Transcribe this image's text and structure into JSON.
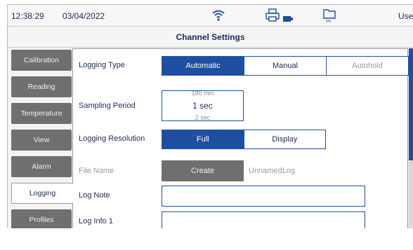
{
  "status_bar": {
    "time": "12:38:29",
    "date": "03/04/2022",
    "user": "User",
    "icons": [
      "wifi-icon",
      "printer-icon",
      "battery-icon",
      "storage-icon"
    ],
    "storage_label": "0%"
  },
  "title": "Channel Settings",
  "sidebar": {
    "items": [
      {
        "label": "Calibration"
      },
      {
        "label": "Reading"
      },
      {
        "label": "Temperature"
      },
      {
        "label": "View"
      },
      {
        "label": "Alarm"
      },
      {
        "label": "Logging",
        "active": true
      },
      {
        "label": "Profiles"
      }
    ]
  },
  "form": {
    "logging_type": {
      "label": "Logging Type",
      "options": [
        "Automatic",
        "Manual",
        "Autohold"
      ],
      "selected": "Automatic"
    },
    "sampling_period": {
      "label": "Sampling Period",
      "above": "180 min",
      "current": "1 sec",
      "below": "2 sec"
    },
    "logging_resolution": {
      "label": "Logging Resolution",
      "options": [
        "Full",
        "Display"
      ],
      "selected": "Full"
    },
    "file_name": {
      "label": "File Name",
      "button": "Create",
      "value": "UnnamedLog"
    },
    "log_note": {
      "label": "Log Note",
      "value": ""
    },
    "log_info_1": {
      "label": "Log Info 1",
      "value": ""
    }
  },
  "colors": {
    "accent": "#1e4fa0",
    "tab_inactive": "#6f6f6f",
    "text": "#1d2a5a",
    "disabled": "#9a9a9a"
  }
}
